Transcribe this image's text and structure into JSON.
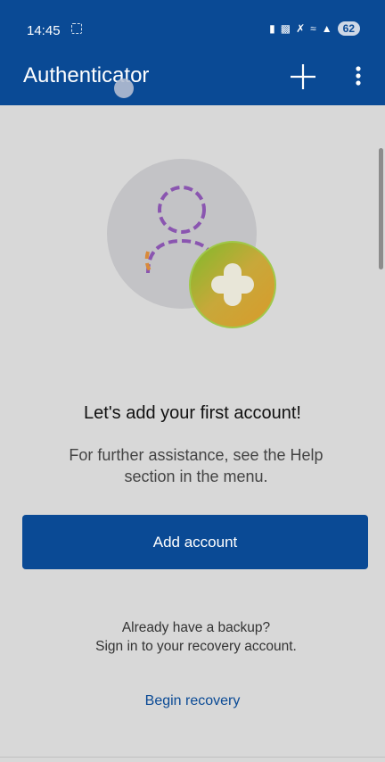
{
  "status_bar": {
    "time": "14:45",
    "battery": "62",
    "icons": [
      "recording-icon",
      "cast-icon",
      "mute-icon",
      "wifi-icon",
      "signal-icon",
      "battery-icon"
    ]
  },
  "app_bar": {
    "title": "Authenticator",
    "add_icon": "plus-icon",
    "menu_icon": "more-vertical-icon",
    "color": "#0a4a95"
  },
  "empty_state": {
    "illustration": "add-user-illustration",
    "headline": "Let's add your first account!",
    "help_line1": "For further assistance, see the Help",
    "help_line2": "section in the menu.",
    "add_button_label": "Add account",
    "backup_line1": "Already have a backup?",
    "backup_line2": "Sign in to your recovery account.",
    "recovery_link": "Begin recovery"
  }
}
